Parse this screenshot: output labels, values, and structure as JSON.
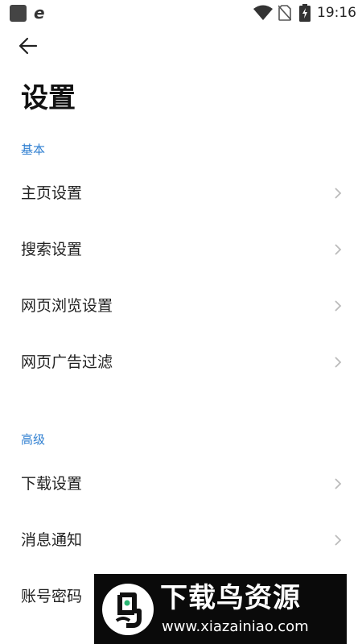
{
  "status_bar": {
    "time": "19:16",
    "app_icon": "e",
    "icons": [
      "app-square-icon",
      "browser-e-icon",
      "wifi-icon",
      "no-sim-icon",
      "battery-charging-icon"
    ]
  },
  "header": {
    "back_icon": "arrow-left-icon"
  },
  "page": {
    "title": "设置"
  },
  "sections": [
    {
      "header": "基本",
      "items": [
        {
          "label": "主页设置"
        },
        {
          "label": "搜索设置"
        },
        {
          "label": "网页浏览设置"
        },
        {
          "label": "网页广告过滤"
        }
      ]
    },
    {
      "header": "高级",
      "items": [
        {
          "label": "下载设置"
        },
        {
          "label": "消息通知"
        },
        {
          "label": "账号密码"
        }
      ]
    }
  ],
  "watermark": {
    "title": "下载鸟资源",
    "url": "www.xiazainiao.com",
    "logo_icon": "bird-logo-icon"
  },
  "colors": {
    "section_header": "#2f7fd1",
    "text": "#222222",
    "chevron": "#bbbbbb",
    "background": "#ffffff"
  }
}
